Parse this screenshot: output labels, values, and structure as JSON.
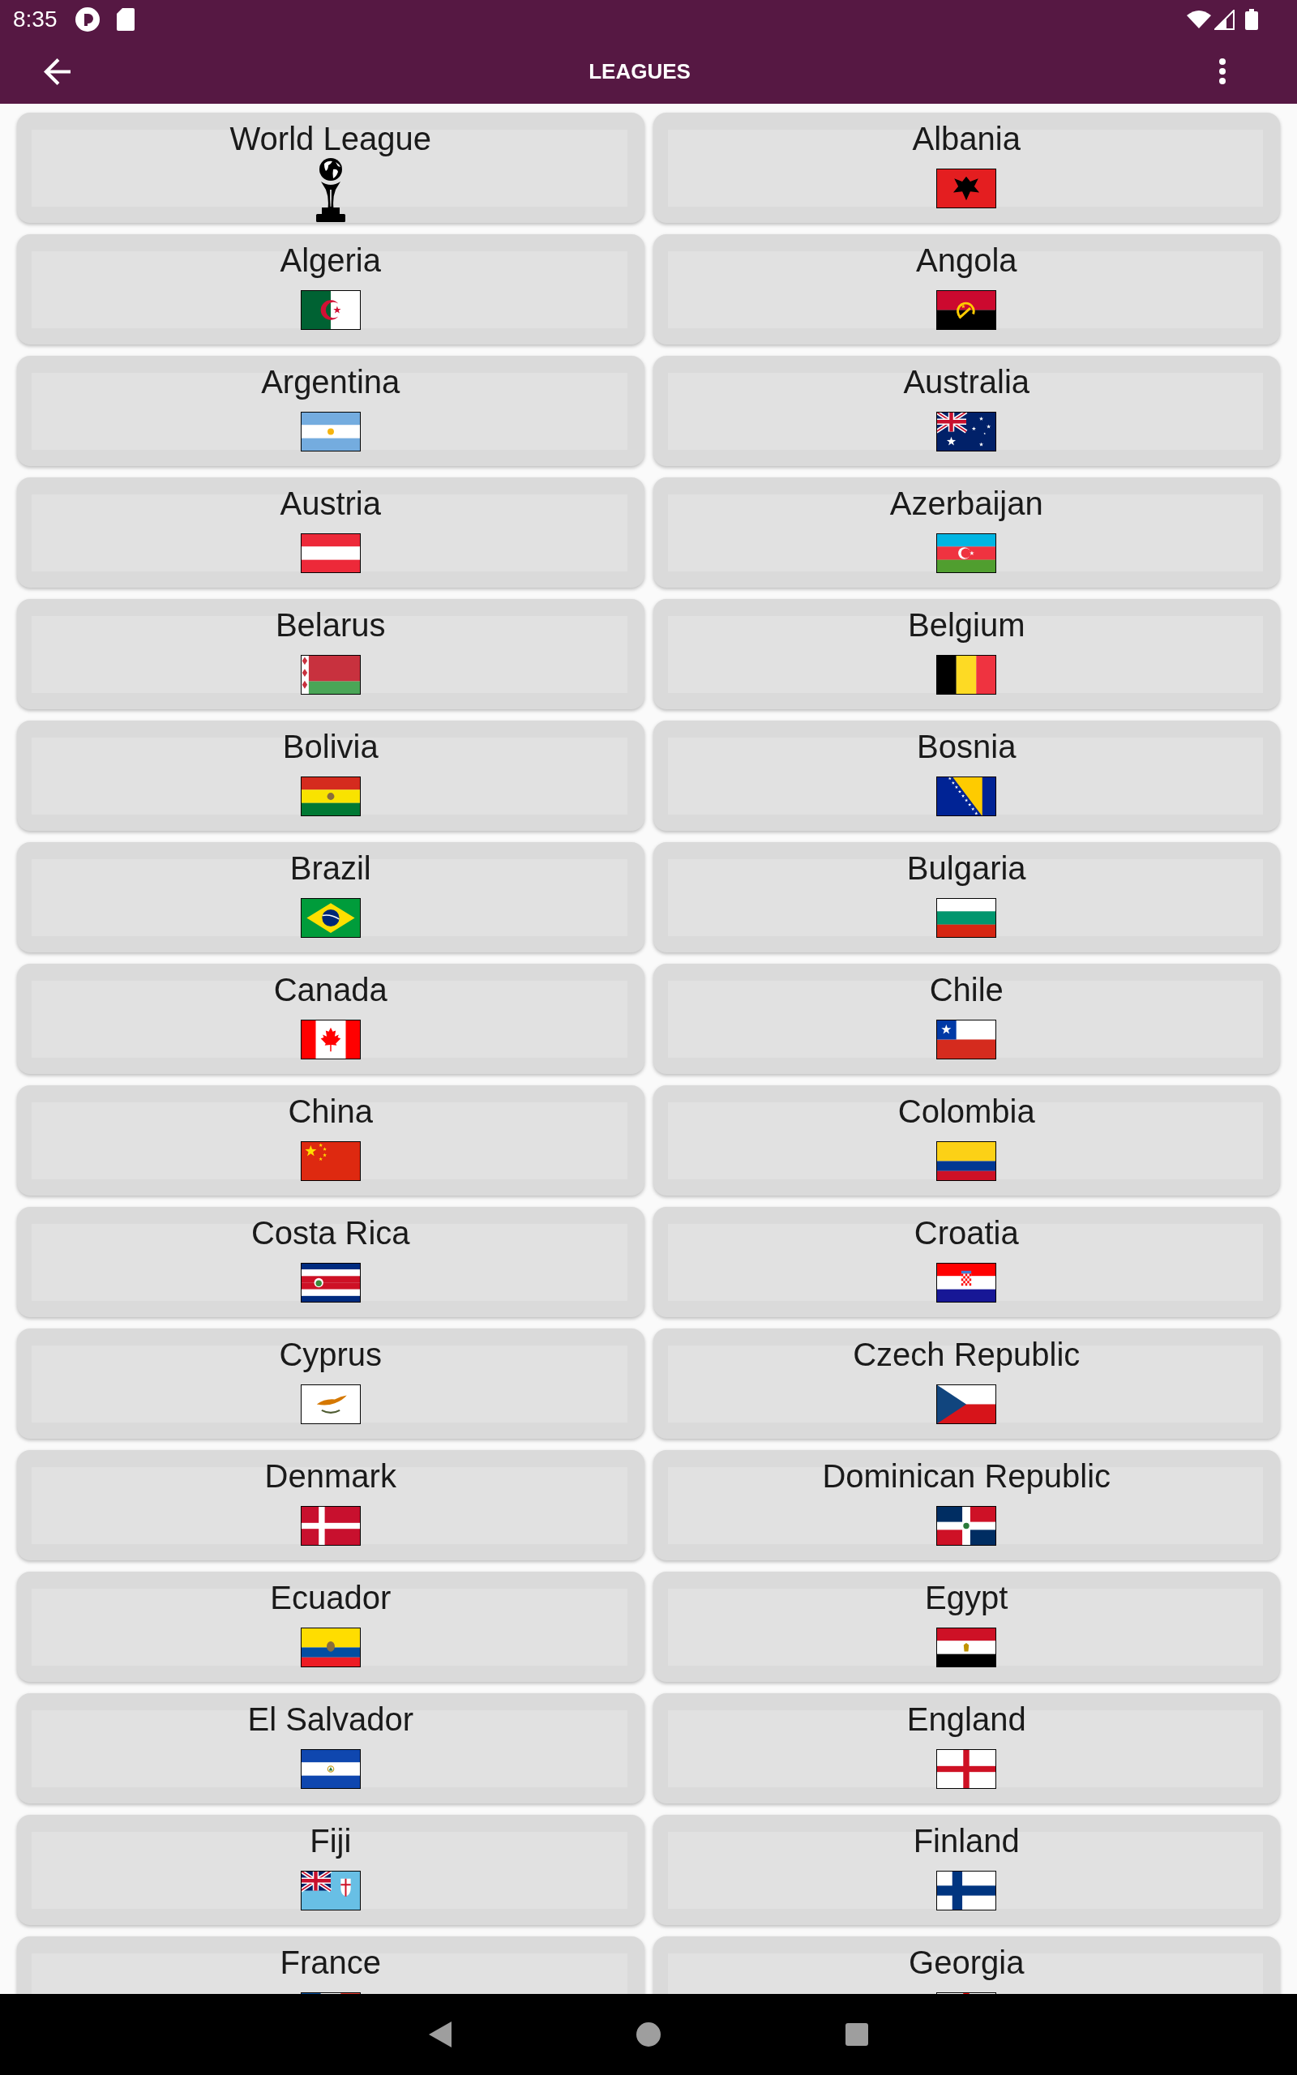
{
  "status_bar": {
    "time": "8:35"
  },
  "app_bar": {
    "title": "LEAGUES"
  },
  "leagues": [
    {
      "name": "World League",
      "kind": "trophy"
    },
    {
      "name": "Albania",
      "kind": "flag"
    },
    {
      "name": "Algeria",
      "kind": "flag"
    },
    {
      "name": "Angola",
      "kind": "flag"
    },
    {
      "name": "Argentina",
      "kind": "flag"
    },
    {
      "name": "Australia",
      "kind": "flag"
    },
    {
      "name": "Austria",
      "kind": "flag"
    },
    {
      "name": "Azerbaijan",
      "kind": "flag"
    },
    {
      "name": "Belarus",
      "kind": "flag"
    },
    {
      "name": "Belgium",
      "kind": "flag"
    },
    {
      "name": "Bolivia",
      "kind": "flag"
    },
    {
      "name": "Bosnia",
      "kind": "flag"
    },
    {
      "name": "Brazil",
      "kind": "flag"
    },
    {
      "name": "Bulgaria",
      "kind": "flag"
    },
    {
      "name": "Canada",
      "kind": "flag"
    },
    {
      "name": "Chile",
      "kind": "flag"
    },
    {
      "name": "China",
      "kind": "flag"
    },
    {
      "name": "Colombia",
      "kind": "flag"
    },
    {
      "name": "Costa Rica",
      "kind": "flag"
    },
    {
      "name": "Croatia",
      "kind": "flag"
    },
    {
      "name": "Cyprus",
      "kind": "flag"
    },
    {
      "name": "Czech Republic",
      "kind": "flag"
    },
    {
      "name": "Denmark",
      "kind": "flag"
    },
    {
      "name": "Dominican Republic",
      "kind": "flag"
    },
    {
      "name": "Ecuador",
      "kind": "flag"
    },
    {
      "name": "Egypt",
      "kind": "flag"
    },
    {
      "name": "El Salvador",
      "kind": "flag"
    },
    {
      "name": "England",
      "kind": "flag"
    },
    {
      "name": "Fiji",
      "kind": "flag"
    },
    {
      "name": "Finland",
      "kind": "flag"
    },
    {
      "name": "France",
      "kind": "flag"
    },
    {
      "name": "Georgia",
      "kind": "flag"
    }
  ]
}
